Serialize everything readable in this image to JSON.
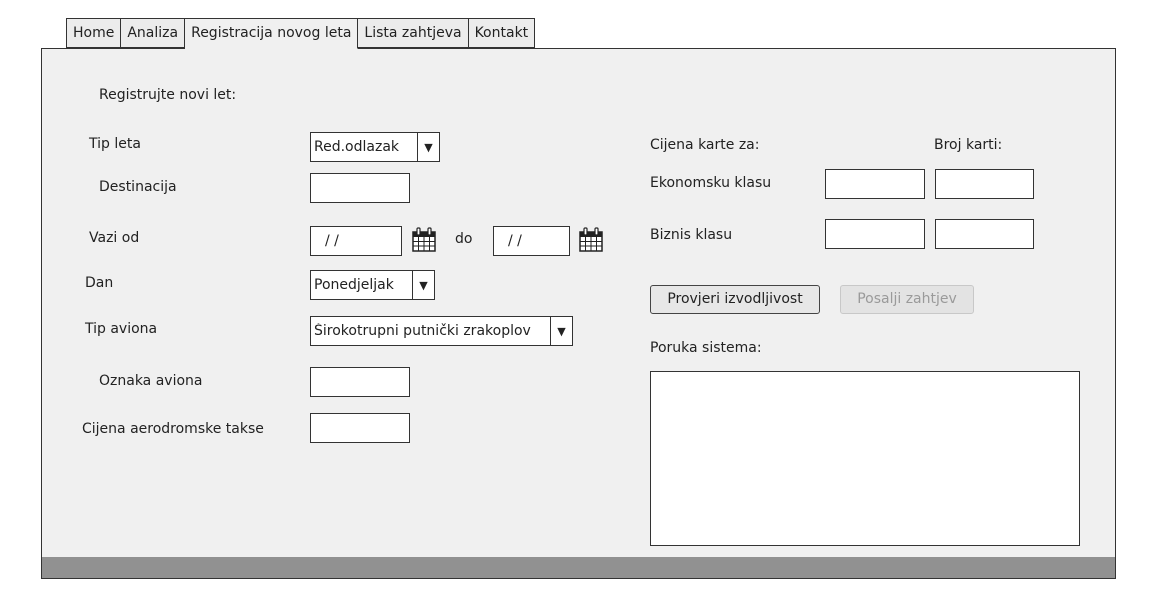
{
  "tabs": [
    {
      "label": "Home"
    },
    {
      "label": "Analiza"
    },
    {
      "label": "Registracija novog leta",
      "active": true
    },
    {
      "label": "Lista zahtjeva"
    },
    {
      "label": "Kontakt"
    }
  ],
  "form": {
    "heading": "Registrujte novi let:",
    "tip_leta": {
      "label": "Tip leta",
      "value": "Red.odlazak"
    },
    "destinacija": {
      "label": "Destinacija",
      "value": ""
    },
    "vazi_od": {
      "label": "Vazi od",
      "from": "/ /",
      "to_label": "do",
      "to": "/ /"
    },
    "dan": {
      "label": "Dan",
      "value": "Ponedjeljak"
    },
    "tip_aviona": {
      "label": "Tip aviona",
      "value": "Širokotrupni putnički zrakoplov"
    },
    "oznaka_aviona": {
      "label": "Oznaka aviona",
      "value": ""
    },
    "cijena_takse": {
      "label": "Cijena aerodromske takse",
      "value": ""
    }
  },
  "pricing": {
    "price_header": "Cijena karte za:",
    "count_header": "Broj karti:",
    "ekonomska": {
      "label": "Ekonomsku klasu",
      "price": "",
      "count": ""
    },
    "biznis": {
      "label": "Biznis klasu",
      "price": "",
      "count": ""
    }
  },
  "actions": {
    "check": "Provjeri izvodljivost",
    "send": "Posalji zahtjev"
  },
  "system_message": {
    "label": "Poruka sistema:",
    "value": ""
  },
  "colors": {
    "panel": "#f0f0f0",
    "footer": "#919191",
    "border": "#333333"
  }
}
